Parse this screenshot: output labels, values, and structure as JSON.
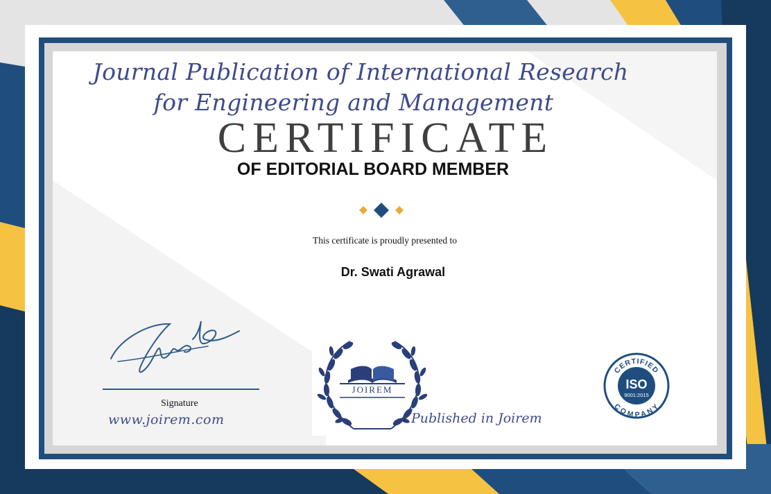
{
  "journal": {
    "line1": "Journal Publication of International Research",
    "line2": "for Engineering and Management"
  },
  "certificate": {
    "headline": "CERTIFICATE",
    "subtitle": "OF EDITORIAL BOARD MEMBER",
    "presented_text": "This certificate is proudly presented to",
    "recipient": "Dr. Swati Agrawal"
  },
  "footer": {
    "signature_label": "Signature",
    "website": "www.joirem.com",
    "published": "Published in Joirem"
  },
  "logo": {
    "text": "JOIREM"
  },
  "iso_badge": {
    "top": "CERTIFIED",
    "center": "ISO",
    "standard": "9001:2015",
    "bottom": "COMPANY"
  },
  "colors": {
    "navy": "#1f4e7e",
    "dark_navy": "#163a5e",
    "gold": "#f5c242",
    "light_gray": "#dcdcdc",
    "text_blue": "#3e4a8a"
  }
}
